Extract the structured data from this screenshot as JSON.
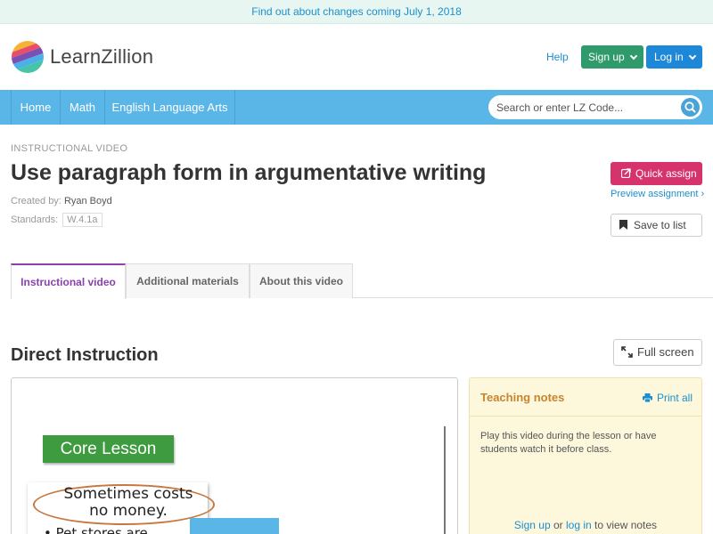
{
  "banner": {
    "text": "Find out about changes coming July 1, 2018"
  },
  "header": {
    "logo_text": "LearnZillion",
    "help": "Help",
    "signup": "Sign up",
    "login": "Log in"
  },
  "nav": {
    "items": [
      "Home",
      "Math",
      "English Language Arts"
    ],
    "search_placeholder": "Search or enter LZ Code..."
  },
  "lesson": {
    "kicker": "INSTRUCTIONAL VIDEO",
    "title": "Use paragraph form in argumentative writing",
    "created_by_label": "Created by:",
    "author": "Ryan Boyd",
    "standards_label": "Standards:",
    "standard": "W.4.1a"
  },
  "actions": {
    "quick_assign": "Quick assign",
    "preview": "Preview assignment ›",
    "save": "Save to list"
  },
  "tabs": [
    "Instructional video",
    "Additional materials",
    "About this video"
  ],
  "section": {
    "title": "Direct Instruction",
    "full_screen": "Full screen"
  },
  "video": {
    "core_lesson": "Core Lesson",
    "paper_line": "Sometimes costs no money.",
    "bullet": "• Pet stores are"
  },
  "notes": {
    "title": "Teaching notes",
    "print_all": "Print all",
    "body": "Play this video during the lesson or have students watch it before class.",
    "signup": "Sign up",
    "or": "or",
    "login": "log in",
    "tail": "to view notes"
  },
  "colors": {
    "nav_blue": "#5bb6e8",
    "signup_green": "#2f9a6c",
    "login_blue": "#1e88d8",
    "quick_assign_pink": "#d6336c",
    "active_tab_purple": "#8b3fb1",
    "notes_bg": "#fdf7dc"
  }
}
